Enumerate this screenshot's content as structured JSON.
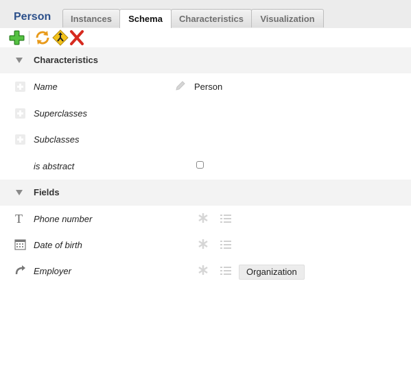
{
  "header": {
    "title": "Person",
    "tabs": [
      {
        "label": "Instances",
        "active": false
      },
      {
        "label": "Schema",
        "active": true
      },
      {
        "label": "Characteristics",
        "active": false
      },
      {
        "label": "Visualization",
        "active": false
      }
    ]
  },
  "toolbar": {
    "buttons": [
      "add-icon",
      "refresh-icon",
      "merge-icon",
      "delete-icon"
    ]
  },
  "characteristics": {
    "section_label": "Characteristics",
    "rows": [
      {
        "label": "Name",
        "value": "Person"
      },
      {
        "label": "Superclasses"
      },
      {
        "label": "Subclasses"
      },
      {
        "label": "is abstract",
        "checked": false
      }
    ]
  },
  "fields": {
    "section_label": "Fields",
    "rows": [
      {
        "label": "Phone number",
        "icon": "text-icon"
      },
      {
        "label": "Date of birth",
        "icon": "calendar-icon"
      },
      {
        "label": "Employer",
        "icon": "relation-arrow-icon",
        "target": "Organization"
      }
    ]
  },
  "colors": {
    "title": "#2b4f8a",
    "section_bg": "#f3f3f3",
    "add_green": "#3aa32c",
    "delete_red": "#d62a1f"
  }
}
